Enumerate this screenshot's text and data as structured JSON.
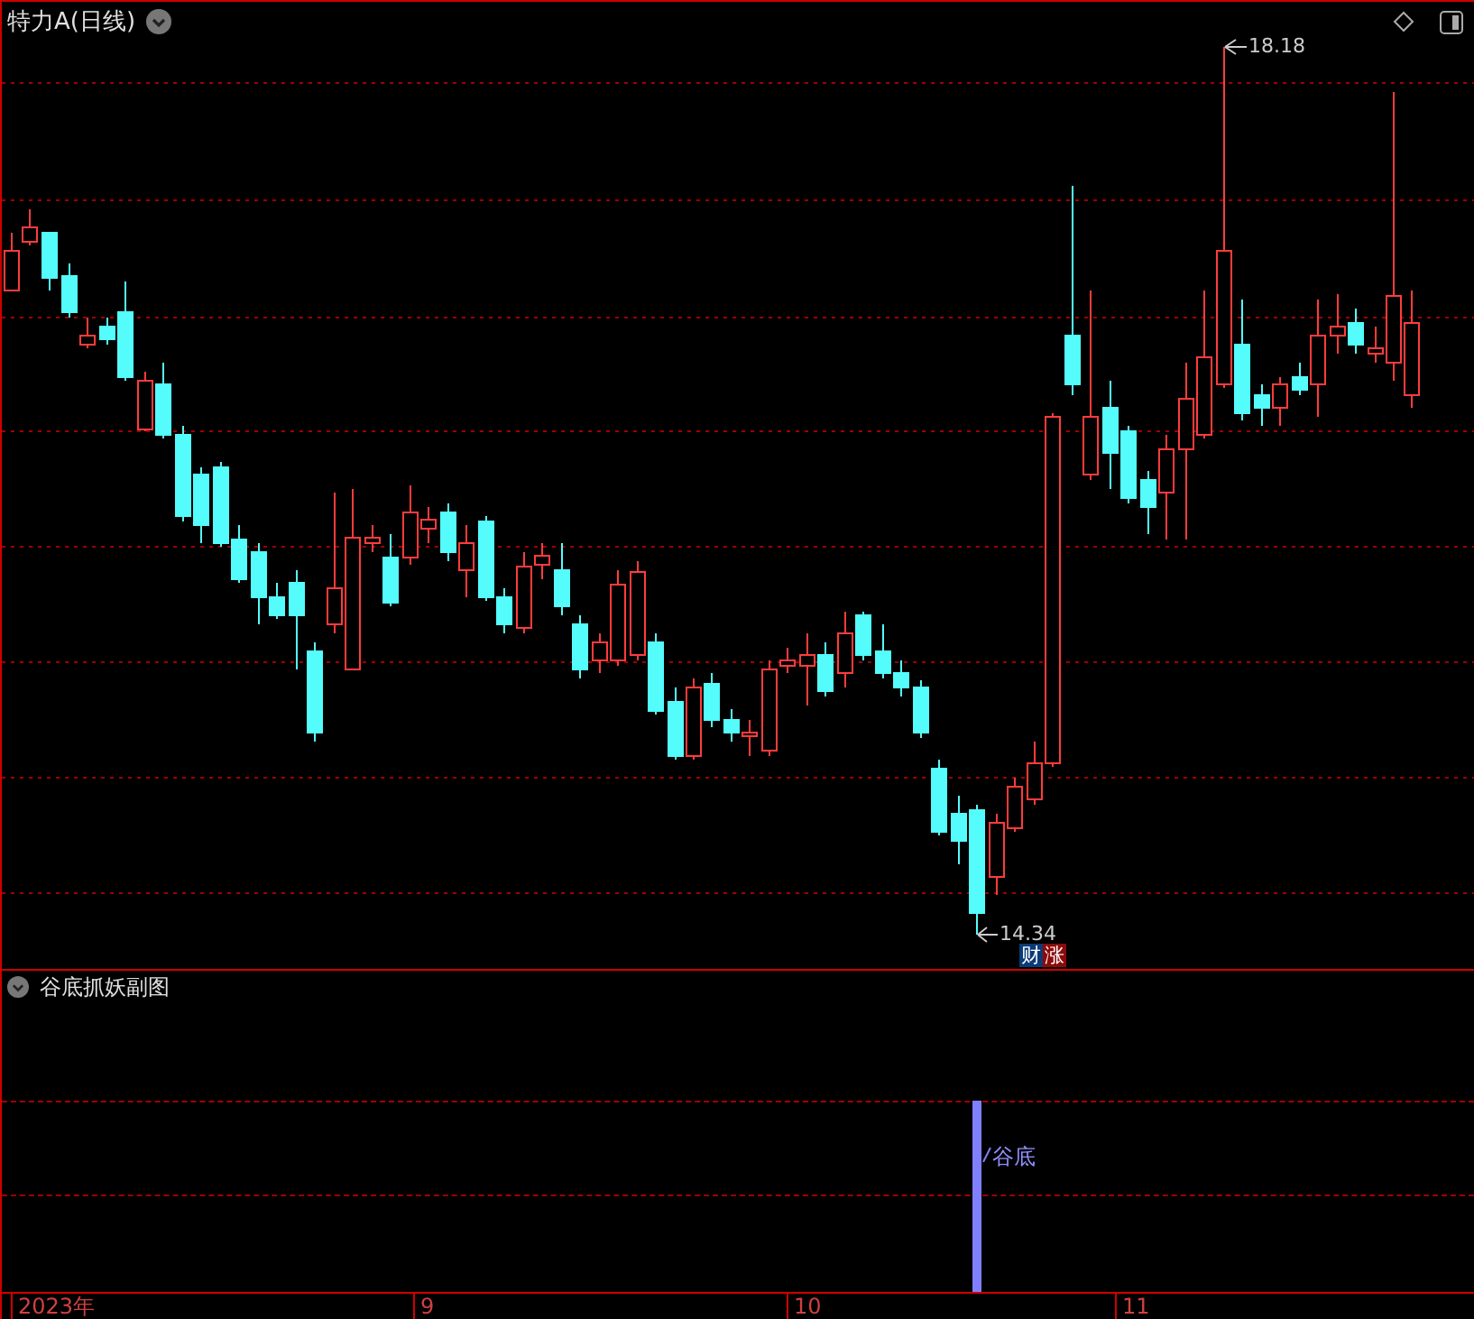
{
  "main_chart": {
    "title": "特力A(日线)",
    "high_label": "18.18",
    "low_label": "14.34",
    "badges": [
      {
        "text": "财",
        "color": "#0a3a78"
      },
      {
        "text": "涨",
        "color": "#8c0a0a"
      }
    ]
  },
  "sub_chart": {
    "title": "谷底抓妖副图",
    "signal_label": "谷底"
  },
  "time_axis": {
    "labels": [
      "2023年",
      "9",
      "10",
      "11"
    ]
  }
}
